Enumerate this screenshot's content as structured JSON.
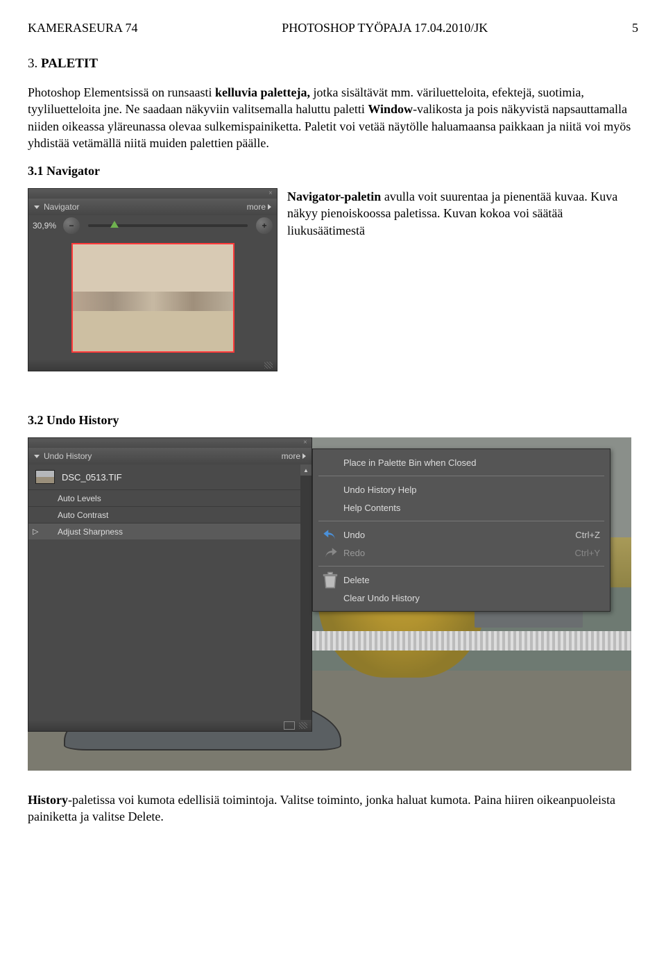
{
  "header": {
    "left": "KAMERASEURA 74",
    "center": "PHOTOSHOP TYÖPAJA 17.04.2010/JK",
    "right": "5"
  },
  "section3": {
    "heading_number": "3. ",
    "heading_label": "PALETIT",
    "para1_a": "Photoshop Elementsissä on runsaasti ",
    "para1_bold1": "kelluvia paletteja,",
    "para1_b": " jotka sisältävät mm. väriluetteloita, efektejä, suotimia, tyyliluetteloita jne. Ne saadaan näkyviin valitsemalla haluttu paletti ",
    "para1_bold2": "Window",
    "para1_c": "-valikosta ja pois näkyvistä napsauttamalla niiden oikeassa yläreunassa olevaa sulkemispainiketta. Paletit voi vetää näytölle haluamaansa paikkaan ja niitä voi myös yhdistää vetämällä niitä muiden palettien päälle."
  },
  "section31": {
    "heading": "3.1 Navigator",
    "tab_label": "Navigator",
    "more_label": "more",
    "zoom_value": "30,9%",
    "desc_bold": "Navigator-paletin",
    "desc_rest": " avulla voit suurentaa ja pienentää kuvaa. Kuva näkyy pienoiskoossa paletissa. Kuvan kokoa voi säätää liukusäätimestä"
  },
  "section32": {
    "heading": "3.2 Undo History",
    "tab_label": "Undo History",
    "more_label": "more",
    "filename": "DSC_0513.TIF",
    "history_items": [
      {
        "label": "Auto Levels",
        "selected": false
      },
      {
        "label": "Auto Contrast",
        "selected": false
      },
      {
        "label": "Adjust Sharpness",
        "selected": true
      }
    ],
    "context_menu": [
      {
        "type": "item",
        "label": "Place in Palette Bin when Closed"
      },
      {
        "type": "sep"
      },
      {
        "type": "item",
        "label": "Undo History Help"
      },
      {
        "type": "item",
        "label": "Help Contents"
      },
      {
        "type": "sep"
      },
      {
        "type": "item",
        "icon": "undo",
        "label": "Undo",
        "shortcut": "Ctrl+Z"
      },
      {
        "type": "item",
        "icon": "redo",
        "label": "Redo",
        "shortcut": "Ctrl+Y",
        "disabled": true
      },
      {
        "type": "sep"
      },
      {
        "type": "item",
        "icon": "trash",
        "label": "Delete"
      },
      {
        "type": "item",
        "label": "Clear Undo History"
      }
    ],
    "footer_bold": "History",
    "footer_rest": "-paletissa voi kumota edellisiä toimintoja. Valitse toiminto, jonka haluat kumota. Paina hiiren oikeanpuoleista painiketta ja valitse Delete."
  }
}
